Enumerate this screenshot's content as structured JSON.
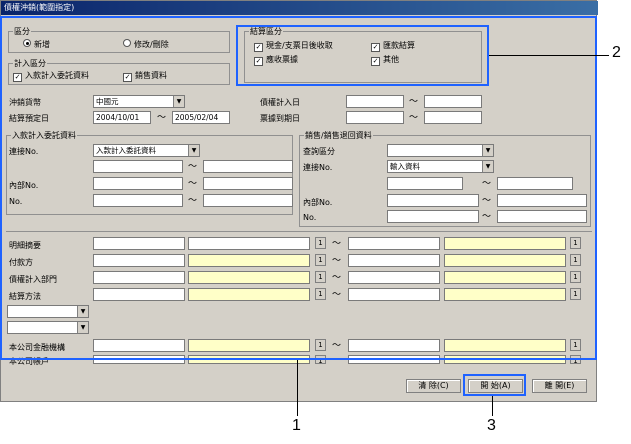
{
  "window": {
    "title": "債權沖銷(範圍指定)"
  },
  "kubun": {
    "label": "區分",
    "new": "新增",
    "edit": "修改/刪除"
  },
  "keisan": {
    "label": "計入區分",
    "opt1": "入款計入委託資料",
    "opt2": "銷售資料"
  },
  "kessan": {
    "label": "結算區分",
    "opt1": "現金/支票日後收取",
    "opt2": "匯款結算",
    "opt3": "應收票據",
    "opt4": "其他"
  },
  "form": {
    "currency_label": "沖銷貨幣",
    "currency_value": "中國元",
    "date_label": "結算預定日",
    "date_from": "2004/10/01",
    "date_to": "2005/02/04",
    "credit_date_label": "債權計入日",
    "bill_date_label": "票據到期日"
  },
  "nyukin": {
    "label": "入款計入委託資料",
    "link_label": "連接No.",
    "link_value": "入款計入委託資料",
    "internal_label": "內部No.",
    "no_label": "No."
  },
  "uriage": {
    "label": "銷售/銷售退回資料",
    "query_label": "查詢區分",
    "link_label": "連接No.",
    "link_value": "輸入資料",
    "internal_label": "內部No.",
    "no_label": "No."
  },
  "rows": {
    "detail": "明細摘要",
    "payer": "付款方",
    "dept": "債權計入部門",
    "method": "結算方法",
    "bank": "本公司金融機構",
    "account": "本公司帳戶"
  },
  "buttons": {
    "clear": "清 除(C)",
    "start": "開 始(A)",
    "close": "離 開(E)",
    "small": "1"
  },
  "tilde": "～",
  "callouts": {
    "c1": "1",
    "c2": "2",
    "c3": "3"
  },
  "colors": {
    "highlight": "#1f62ff",
    "yellow_field": "#ffffc8"
  }
}
